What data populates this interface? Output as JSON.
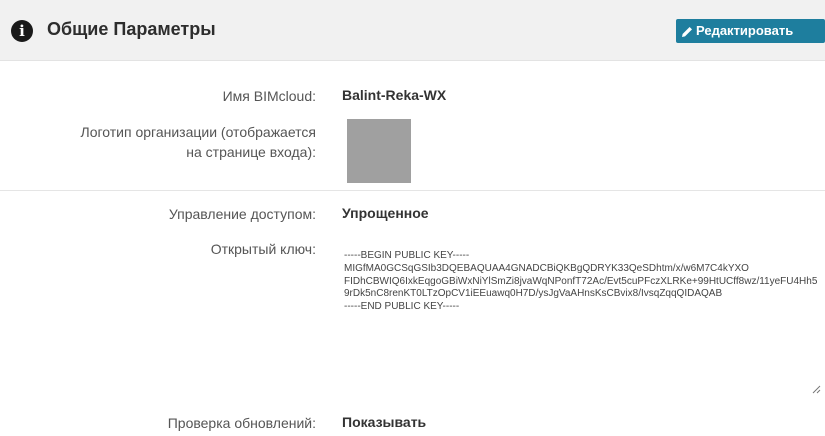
{
  "header": {
    "title": "Общие Параметры",
    "edit_label": "Редактировать"
  },
  "fields": {
    "bimcloud_name": {
      "label": "Имя BIMcloud:",
      "value": "Balint-Reka-WX"
    },
    "logo": {
      "label_line1": "Логотип организации (отображается",
      "label_line2": "на странице входа):"
    },
    "access": {
      "label": "Управление доступом:",
      "value": "Упрощенное"
    },
    "public_key": {
      "label": "Открытый ключ:",
      "value": "-----BEGIN PUBLIC KEY-----\nMIGfMA0GCSqGSIb3DQEBAQUAA4GNADCBiQKBgQDRYK33QeSDhtm/x/w6M7C4kYXO\nFIDhCBWIQ6IxkEqgoGBiWxNiYlSmZi8jvaWqNPonfT72Ac/Evt5cuPFczXLRKe+99HtUCff8wz/11yeFU4Hh59rDk5nC8renKT0LTzOpCV1iEEuawq0H7D/ysJgVaAHnsKsCBvix8/IvsqZqqQIDAQAB\n-----END PUBLIC KEY-----"
    },
    "updates": {
      "label": "Проверка обновлений:",
      "value": "Показывать"
    }
  },
  "colors": {
    "accent": "#1e7e9e",
    "header_bg": "#f1f1f1"
  },
  "icons": {
    "header": "info-circle-icon",
    "edit": "pencil-icon"
  }
}
